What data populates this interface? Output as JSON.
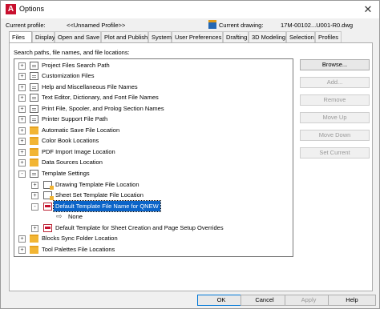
{
  "window": {
    "title": "Options"
  },
  "profile": {
    "label": "Current profile:",
    "value": "<<Unnamed Profile>>",
    "drawing_label": "Current drawing:",
    "drawing_value": "17M-00102...U001-R0.dwg"
  },
  "tabs": [
    {
      "label": "Files",
      "active": true
    },
    {
      "label": "Display"
    },
    {
      "label": "Open and Save"
    },
    {
      "label": "Plot and Publish"
    },
    {
      "label": "System"
    },
    {
      "label": "User Preferences"
    },
    {
      "label": "Drafting"
    },
    {
      "label": "3D Modeling"
    },
    {
      "label": "Selection"
    },
    {
      "label": "Profiles"
    }
  ],
  "files": {
    "tree_label": "Search paths, file names, and file locations:",
    "tree": [
      {
        "label": "Project Files Search Path",
        "icon": "doc-icon",
        "expander": "+"
      },
      {
        "label": "Customization Files",
        "icon": "doc-icon",
        "expander": "+"
      },
      {
        "label": "Help and Miscellaneous File Names",
        "icon": "doc-icon",
        "expander": "+"
      },
      {
        "label": "Text Editor, Dictionary, and Font File Names",
        "icon": "doc-icon",
        "expander": "+"
      },
      {
        "label": "Print File, Spooler, and Prolog Section Names",
        "icon": "doc-icon",
        "expander": "+"
      },
      {
        "label": "Printer Support File Path",
        "icon": "doc-icon",
        "expander": "+"
      },
      {
        "label": "Automatic Save File Location",
        "icon": "folder-icon",
        "expander": "+"
      },
      {
        "label": "Color Book Locations",
        "icon": "folder-icon",
        "expander": "+"
      },
      {
        "label": "PDF Import Image Location",
        "icon": "folder-icon",
        "expander": "+"
      },
      {
        "label": "Data Sources Location",
        "icon": "folder-icon",
        "expander": "+"
      },
      {
        "label": "Template Settings",
        "icon": "doc-icon",
        "expander": "-"
      },
      {
        "label": "Drawing Template File Location",
        "icon": "template-folder-icon",
        "expander": "+"
      },
      {
        "label": "Sheet Set Template File Location",
        "icon": "template-folder-icon",
        "expander": "+"
      },
      {
        "label": "Default Template File Name for QNEW",
        "icon": "red-file-icon",
        "expander": "-",
        "selected": true
      },
      {
        "label": "None",
        "icon": "arrow-icon"
      },
      {
        "label": "Default Template for Sheet Creation and Page Setup Overrides",
        "icon": "red-file-icon",
        "expander": "+"
      },
      {
        "label": "Blocks Sync Folder Location",
        "icon": "folder-icon",
        "expander": "+"
      },
      {
        "label": "Tool Palettes File Locations",
        "icon": "folder-icon",
        "expander": "+"
      }
    ],
    "buttons": {
      "browse": "Browse...",
      "add": "Add...",
      "remove": "Remove",
      "move_up": "Move Up",
      "move_down": "Move Down",
      "set_current": "Set Current"
    }
  },
  "footer": {
    "ok": "OK",
    "cancel": "Cancel",
    "apply": "Apply",
    "help": "Help"
  }
}
